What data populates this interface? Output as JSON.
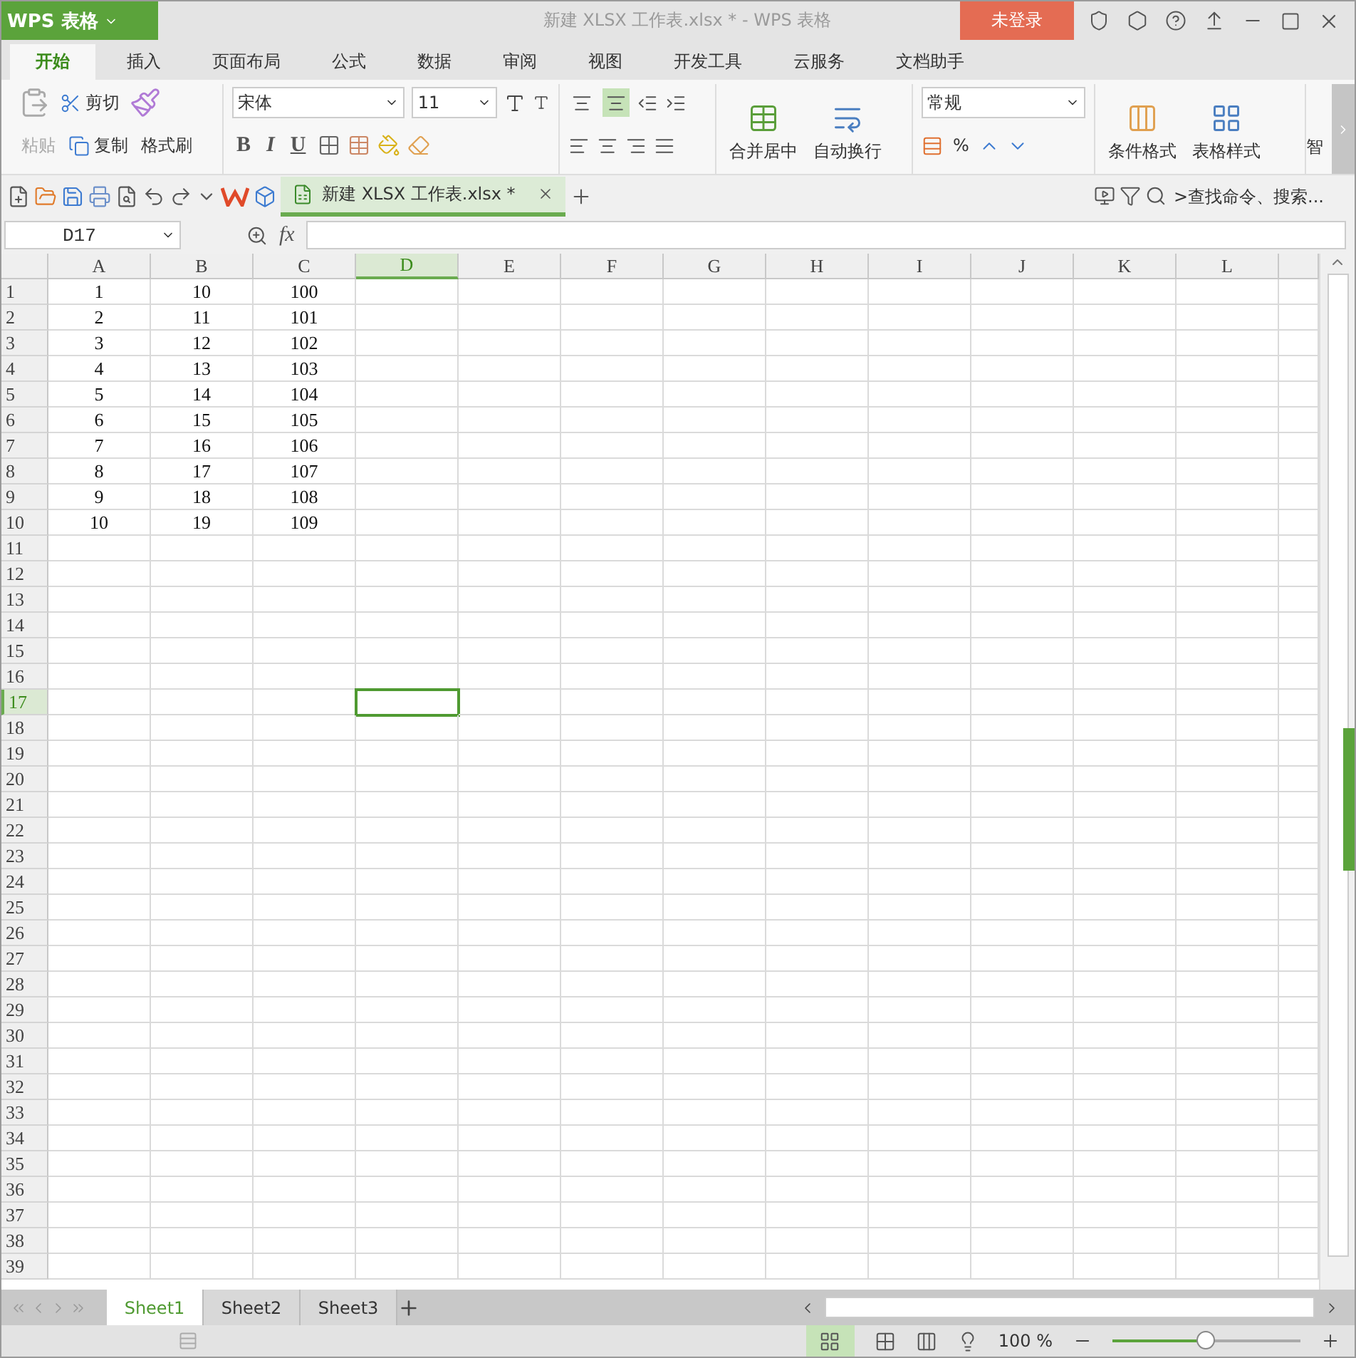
{
  "app_menu": {
    "label": "WPS 表格"
  },
  "window": {
    "title": "新建 XLSX 工作表.xlsx * - WPS 表格"
  },
  "login_button": {
    "label": "未登录"
  },
  "ribbon_tabs": [
    {
      "label": "开始",
      "selected": true
    },
    {
      "label": "插入",
      "selected": false
    },
    {
      "label": "页面布局",
      "selected": false
    },
    {
      "label": "公式",
      "selected": false
    },
    {
      "label": "数据",
      "selected": false
    },
    {
      "label": "审阅",
      "selected": false
    },
    {
      "label": "视图",
      "selected": false
    },
    {
      "label": "开发工具",
      "selected": false
    },
    {
      "label": "云服务",
      "selected": false
    },
    {
      "label": "文档助手",
      "selected": false
    }
  ],
  "ribbon": {
    "paste": "粘贴",
    "cut": "剪切",
    "copy": "复制",
    "format_painter": "格式刷",
    "font": "宋体",
    "font_size": "11",
    "bold": "B",
    "italic": "I",
    "underline": "U",
    "merge": "合并居中",
    "wrap": "自动换行",
    "number_format": "常规",
    "percent": "%",
    "conditional_format": "条件格式",
    "table_style": "表格样式",
    "cut_off_label": "智"
  },
  "document_tabs": [
    {
      "label": "新建 XLSX 工作表.xlsx *",
      "selected": true
    }
  ],
  "search": {
    "placeholder": ">查找命令、搜索..."
  },
  "formula_bar": {
    "name_box": "D17",
    "fx": "fx"
  },
  "sheet": {
    "columns": [
      {
        "label": "A",
        "selected": false
      },
      {
        "label": "B",
        "selected": false
      },
      {
        "label": "C",
        "selected": false
      },
      {
        "label": "D",
        "selected": true
      },
      {
        "label": "E",
        "selected": false
      },
      {
        "label": "F",
        "selected": false
      },
      {
        "label": "G",
        "selected": false
      },
      {
        "label": "H",
        "selected": false
      },
      {
        "label": "I",
        "selected": false
      },
      {
        "label": "J",
        "selected": false
      },
      {
        "label": "K",
        "selected": false
      },
      {
        "label": "L",
        "selected": false
      }
    ],
    "rows": [
      {
        "label": "1",
        "selected": false,
        "cells": [
          "1",
          "10",
          "100"
        ]
      },
      {
        "label": "2",
        "selected": false,
        "cells": [
          "2",
          "11",
          "101"
        ]
      },
      {
        "label": "3",
        "selected": false,
        "cells": [
          "3",
          "12",
          "102"
        ]
      },
      {
        "label": "4",
        "selected": false,
        "cells": [
          "4",
          "13",
          "103"
        ]
      },
      {
        "label": "5",
        "selected": false,
        "cells": [
          "5",
          "14",
          "104"
        ]
      },
      {
        "label": "6",
        "selected": false,
        "cells": [
          "6",
          "15",
          "105"
        ]
      },
      {
        "label": "7",
        "selected": false,
        "cells": [
          "7",
          "16",
          "106"
        ]
      },
      {
        "label": "8",
        "selected": false,
        "cells": [
          "8",
          "17",
          "107"
        ]
      },
      {
        "label": "9",
        "selected": false,
        "cells": [
          "9",
          "18",
          "108"
        ]
      },
      {
        "label": "10",
        "selected": false,
        "cells": [
          "10",
          "19",
          "109"
        ]
      },
      {
        "label": "11",
        "selected": false
      },
      {
        "label": "12",
        "selected": false
      },
      {
        "label": "13",
        "selected": false
      },
      {
        "label": "14",
        "selected": false
      },
      {
        "label": "15",
        "selected": false
      },
      {
        "label": "16",
        "selected": false
      },
      {
        "label": "17",
        "selected": true
      },
      {
        "label": "18",
        "selected": false
      },
      {
        "label": "19",
        "selected": false
      },
      {
        "label": "20",
        "selected": false
      },
      {
        "label": "21",
        "selected": false
      },
      {
        "label": "22",
        "selected": false
      },
      {
        "label": "23",
        "selected": false
      },
      {
        "label": "24",
        "selected": false
      },
      {
        "label": "25",
        "selected": false
      },
      {
        "label": "26",
        "selected": false
      },
      {
        "label": "27",
        "selected": false
      },
      {
        "label": "28",
        "selected": false
      },
      {
        "label": "29",
        "selected": false
      },
      {
        "label": "30",
        "selected": false
      },
      {
        "label": "31",
        "selected": false
      },
      {
        "label": "32",
        "selected": false
      },
      {
        "label": "33",
        "selected": false
      },
      {
        "label": "34",
        "selected": false
      },
      {
        "label": "35",
        "selected": false
      },
      {
        "label": "36",
        "selected": false
      },
      {
        "label": "37",
        "selected": false
      },
      {
        "label": "38",
        "selected": false
      },
      {
        "label": "39",
        "selected": false
      }
    ]
  },
  "sheet_tabs": [
    {
      "label": "Sheet1",
      "selected": true
    },
    {
      "label": "Sheet2",
      "selected": false
    },
    {
      "label": "Sheet3",
      "selected": false
    }
  ],
  "status_bar": {
    "zoom": {
      "reading": "100 %",
      "level": 0.5
    }
  }
}
